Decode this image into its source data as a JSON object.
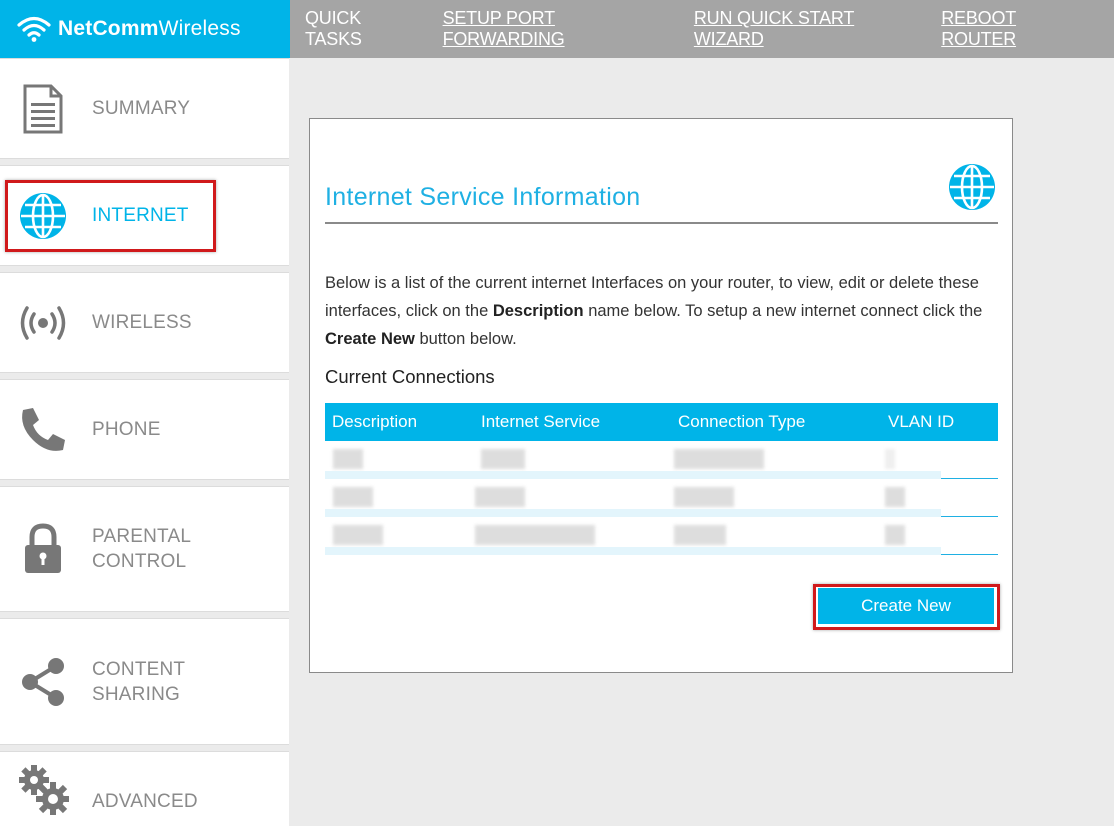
{
  "brand": {
    "name_bold": "NetComm",
    "name_rest": "Wireless",
    "color": "#00b4e8"
  },
  "topbar": {
    "quick_tasks": "QUICK TASKS",
    "links": [
      "SETUP PORT FORWARDING",
      "RUN QUICK START WIZARD",
      "REBOOT ROUTER"
    ]
  },
  "sidebar": {
    "items": [
      {
        "label": "SUMMARY",
        "icon": "document-icon"
      },
      {
        "label": "INTERNET",
        "icon": "globe-icon",
        "active": true
      },
      {
        "label": "WIRELESS",
        "icon": "wireless-signal-icon"
      },
      {
        "label": "PHONE",
        "icon": "phone-icon"
      },
      {
        "label": "PARENTAL",
        "label2": "CONTROL",
        "icon": "lock-icon"
      },
      {
        "label": "CONTENT",
        "label2": "SHARING",
        "icon": "share-icon"
      },
      {
        "label": "ADVANCED",
        "icon": "gears-icon"
      }
    ]
  },
  "main": {
    "title": "Internet Service Information",
    "description": {
      "part1": "Below is a list of the current internet Interfaces on your router, to view, edit or delete these interfaces, click on the ",
      "bold1": "Description",
      "part2": " name below. To setup a new internet connect click the ",
      "bold2": "Create New",
      "part3": " button below."
    },
    "section_title": "Current Connections",
    "table": {
      "columns": [
        "Description",
        "Internet Service",
        "Connection Type",
        "VLAN ID"
      ],
      "rows": 3
    },
    "create_button": "Create New"
  },
  "colors": {
    "accent": "#00b4e8",
    "highlight": "#d0191b",
    "muted_text": "#8a8a8a"
  }
}
